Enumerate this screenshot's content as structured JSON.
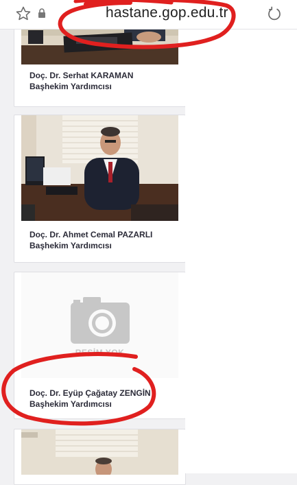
{
  "browser": {
    "url": "hastane.gop.edu.tr"
  },
  "staff": [
    {
      "name": "Doç. Dr. Serhat KARAMAN",
      "title": "Başhekim Yardımcısı"
    },
    {
      "name": "Doç. Dr. Ahmet Cemal PAZARLI",
      "title": "Başhekim Yardımcısı"
    },
    {
      "name": "Doç. Dr. Eyüp Çağatay ZENGİN",
      "title": "Başhekim Yardımcısı",
      "photo_placeholder": "RESİM YOK"
    },
    {
      "name": "",
      "title": ""
    }
  ],
  "colors": {
    "annotation": "#e0201f",
    "name_text": "#2b2b38"
  },
  "icons": [
    "star-icon",
    "lock-icon",
    "reload-icon",
    "camera-icon"
  ]
}
